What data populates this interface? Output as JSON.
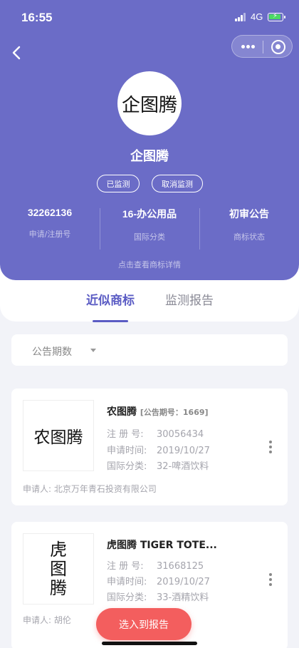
{
  "status_bar": {
    "time": "16:55",
    "network": "4G"
  },
  "header": {
    "logo_text": "企图腾",
    "brand_name": "企图腾",
    "buttons": {
      "monitored": "已监测",
      "cancel_monitor": "取消监测"
    },
    "stats": [
      {
        "value": "32262136",
        "label": "申请/注册号"
      },
      {
        "value": "16-办公用品",
        "label": "国际分类"
      },
      {
        "value": "初审公告",
        "label": "商标状态"
      }
    ],
    "detail_link": "点击查看商标详情"
  },
  "tabs": [
    {
      "label": "近似商标",
      "active": true
    },
    {
      "label": "监测报告",
      "active": false
    }
  ],
  "filter": {
    "label": "公告期数"
  },
  "results": [
    {
      "thumb_text": "农图腾",
      "name": "农图腾",
      "tag": "[公告期号：1669]",
      "reg_no_label": "注 册 号:",
      "reg_no": "30056434",
      "apply_date_label": "申请时间:",
      "apply_date": "2019/10/27",
      "class_label": "国际分类:",
      "class": "32-啤酒饮料",
      "applicant_label": "申请人:",
      "applicant": "北京万年青石投资有限公司"
    },
    {
      "thumb_chars": [
        "虎",
        "图",
        "腾"
      ],
      "name": "虎图腾 TIGER TOTE...",
      "reg_no_label": "注 册 号:",
      "reg_no": "31668125",
      "apply_date_label": "申请时间:",
      "apply_date": "2019/10/27",
      "class_label": "国际分类:",
      "class": "33-酒精饮料",
      "applicant_label": "申请人:",
      "applicant": "胡伦"
    }
  ],
  "cta": {
    "label": "选入到报告"
  },
  "colors": {
    "primary": "#6b6cc7",
    "accent": "#5b5cc4",
    "cta": "#f35e5e"
  }
}
